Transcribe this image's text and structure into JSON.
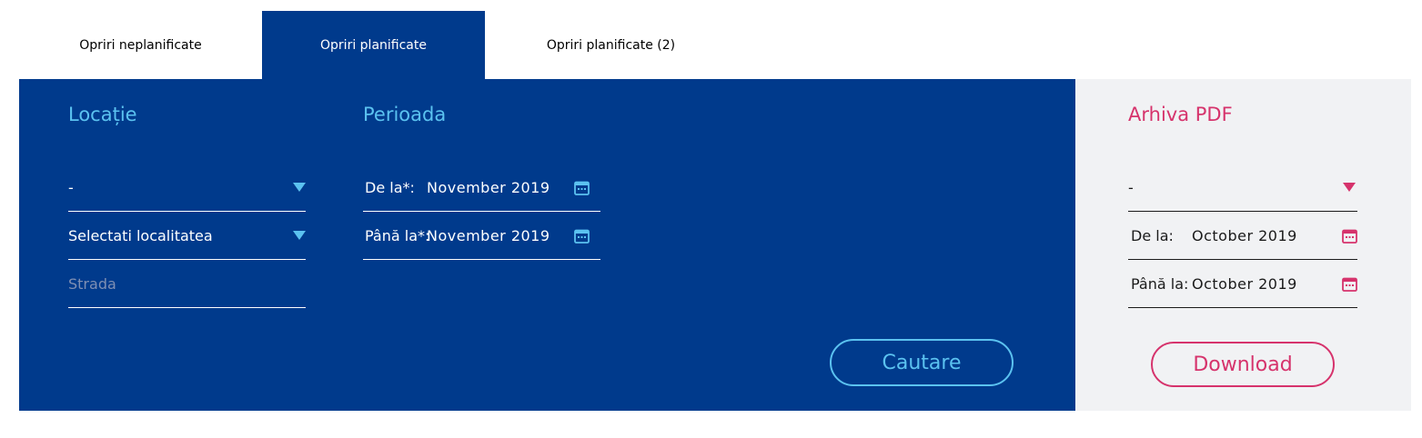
{
  "tabs": [
    {
      "label": "Opriri neplanificate"
    },
    {
      "label": "Opriri planificate"
    },
    {
      "label": "Opriri planificate (2)"
    }
  ],
  "location": {
    "title": "Locație",
    "county_value": "-",
    "locality_value": "Selectati localitatea",
    "street_placeholder": "Strada"
  },
  "period": {
    "title": "Perioada",
    "from_label": "De la*:",
    "from_value": "November 2019",
    "to_label": "Până la*:",
    "to_value": "November 2019"
  },
  "search_button": {
    "label": "Cautare"
  },
  "archive": {
    "title": "Arhiva PDF",
    "select_value": "-",
    "from_label": "De la:",
    "from_value": "October 2019",
    "to_label": "Până la:",
    "to_value": "October 2019",
    "download_label": "Download"
  },
  "colors": {
    "panel_blue": "#003a8c",
    "accent_blue": "#5bc2f0",
    "accent_pink": "#d6336c",
    "panel_gray": "#f1f2f4"
  },
  "icons": [
    "chevron-down-icon",
    "calendar-icon"
  ]
}
